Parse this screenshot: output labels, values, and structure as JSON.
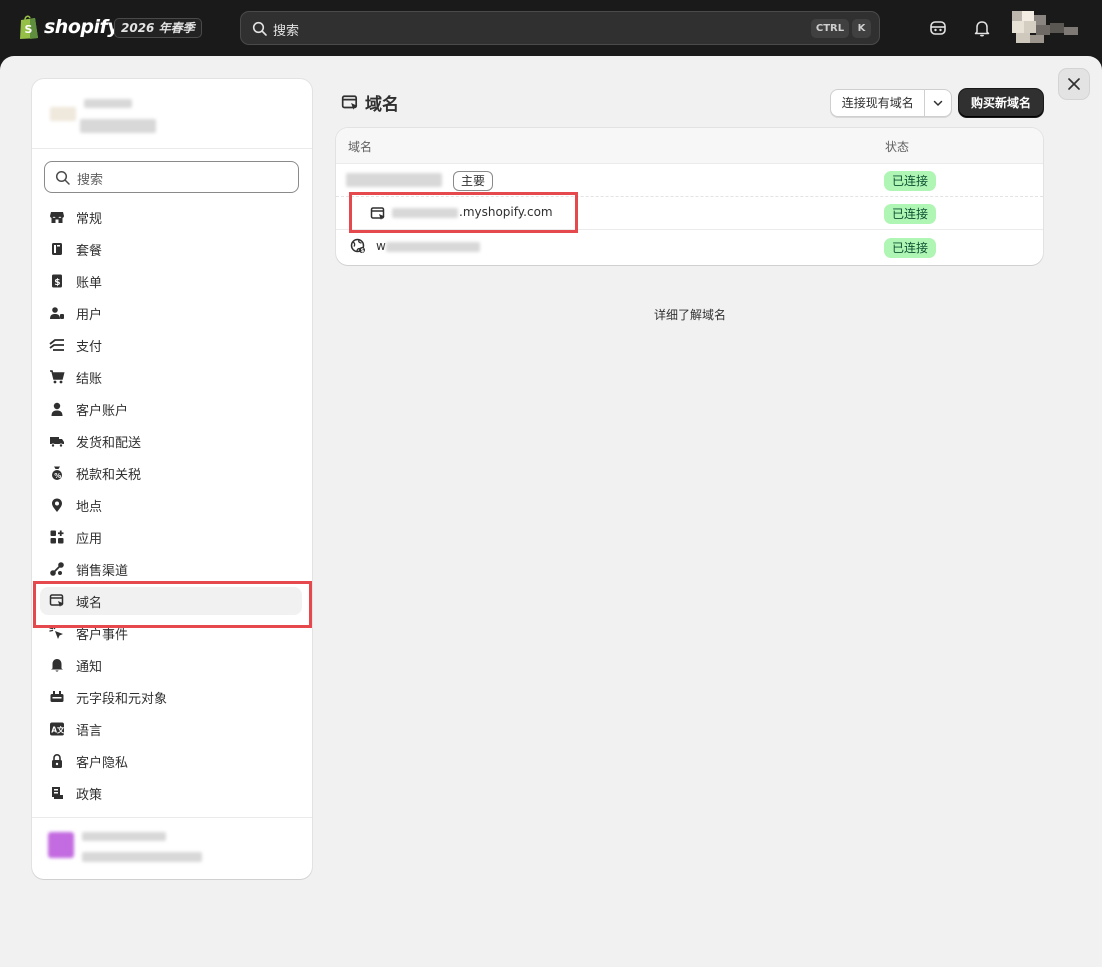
{
  "topbar": {
    "logo_text": "shopify",
    "edition": "2026 年春季",
    "search_placeholder": "搜索",
    "kbd_ctrl": "CTRL",
    "kbd_k": "K",
    "icons": [
      "shopify-bag-icon",
      "search-icon",
      "store-chat-icon",
      "bell-icon"
    ]
  },
  "sidebar": {
    "search_placeholder": "搜索",
    "items": [
      {
        "label": "常规",
        "icon": "store-icon"
      },
      {
        "label": "套餐",
        "icon": "plan-icon"
      },
      {
        "label": "账单",
        "icon": "billing-icon"
      },
      {
        "label": "用户",
        "icon": "users-icon"
      },
      {
        "label": "支付",
        "icon": "payments-icon"
      },
      {
        "label": "结账",
        "icon": "cart-icon"
      },
      {
        "label": "客户账户",
        "icon": "person-icon"
      },
      {
        "label": "发货和配送",
        "icon": "truck-icon"
      },
      {
        "label": "税款和关税",
        "icon": "tax-icon"
      },
      {
        "label": "地点",
        "icon": "location-icon"
      },
      {
        "label": "应用",
        "icon": "apps-icon"
      },
      {
        "label": "销售渠道",
        "icon": "channels-icon"
      },
      {
        "label": "域名",
        "icon": "domains-icon",
        "active": true
      },
      {
        "label": "客户事件",
        "icon": "cursor-icon"
      },
      {
        "label": "通知",
        "icon": "bell-icon"
      },
      {
        "label": "元字段和元对象",
        "icon": "metafields-icon"
      },
      {
        "label": "语言",
        "icon": "language-icon"
      },
      {
        "label": "客户隐私",
        "icon": "lock-icon"
      },
      {
        "label": "政策",
        "icon": "policy-icon"
      }
    ]
  },
  "main": {
    "title": "域名",
    "connect_button": "连接现有域名",
    "buy_button": "购买新域名",
    "table": {
      "col_domain": "域名",
      "col_status": "状态",
      "rows": [
        {
          "domain": "",
          "badge": "主要",
          "status": "已连接"
        },
        {
          "domain": ".myshopify.com",
          "status": "已连接"
        },
        {
          "domain": "w",
          "status": "已连接"
        }
      ]
    },
    "learn_more": "详细了解域名"
  },
  "colors": {
    "topbar_bg": "#1a1a1a",
    "panel_bg": "#f1f1f1",
    "status_bg": "#aff5b4",
    "status_text": "#0c5132",
    "highlight": "#e5484d"
  }
}
